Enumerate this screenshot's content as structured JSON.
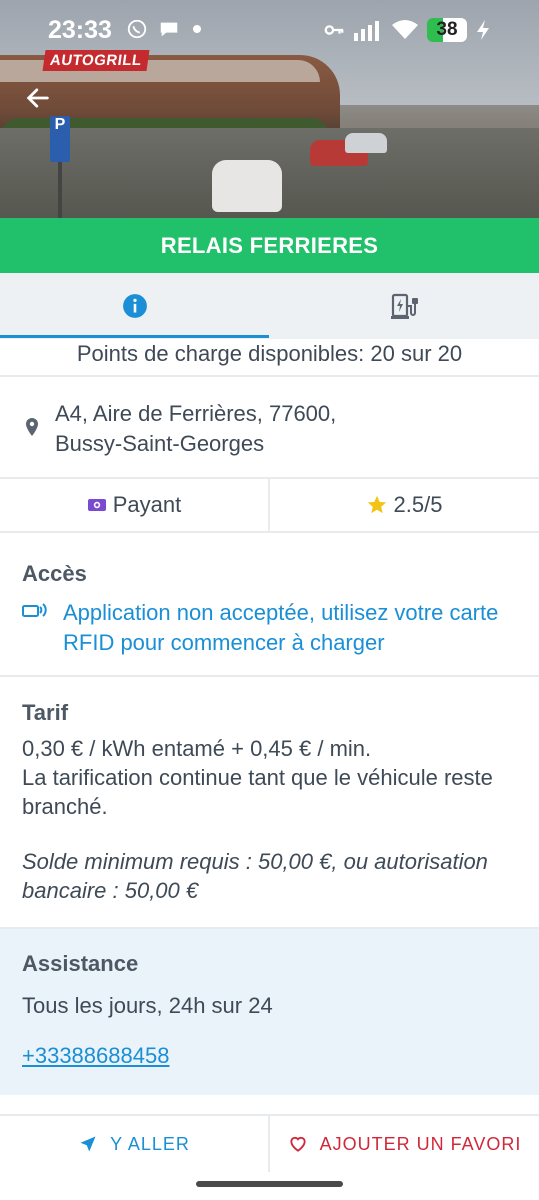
{
  "status_bar": {
    "time": "23:33",
    "battery": "38",
    "icons": [
      "whatsapp-icon",
      "chat-icon",
      "dot-icon",
      "key-icon",
      "signal-icon",
      "wifi-icon",
      "battery-icon",
      "charging-icon"
    ]
  },
  "hero": {
    "sign_text": "AUTOGRILL",
    "parking_sign": "P"
  },
  "station": {
    "name": "RELAIS FERRIERES"
  },
  "tabs": [
    {
      "name": "info",
      "icon": "info-icon",
      "active": true
    },
    {
      "name": "charging",
      "icon": "charging-station-icon",
      "active": false
    }
  ],
  "points": "Points de charge disponibles: 20 sur 20",
  "address": {
    "line1": "A4, Aire de Ferrières, 77600,",
    "line2": "Bussy-Saint-Georges"
  },
  "pricing_badge": "Payant",
  "rating": "2.5/5",
  "access": {
    "title": "Accès",
    "message": "Application non acceptée, utilisez votre carte RFID pour commencer à charger"
  },
  "tarif": {
    "title": "Tarif",
    "line1": "0,30 € / kWh entamé + 0,45 € / min.",
    "line2": "La tarification continue tant que le véhicule reste branché.",
    "note": "Solde minimum requis : 50,00 €, ou autorisation bancaire : 50,00 €"
  },
  "assistance": {
    "title": "Assistance",
    "hours": "Tous les jours, 24h sur 24",
    "phone": "+33388688458"
  },
  "actions": {
    "go": "Y ALLER",
    "favorite": "AJOUTER UN FAVORI"
  },
  "colors": {
    "brand_green": "#21c16b",
    "link_blue": "#1a8fd6",
    "favorite_red": "#d0283a",
    "star_yellow": "#f2c418",
    "money_purple": "#7a4bd0"
  }
}
